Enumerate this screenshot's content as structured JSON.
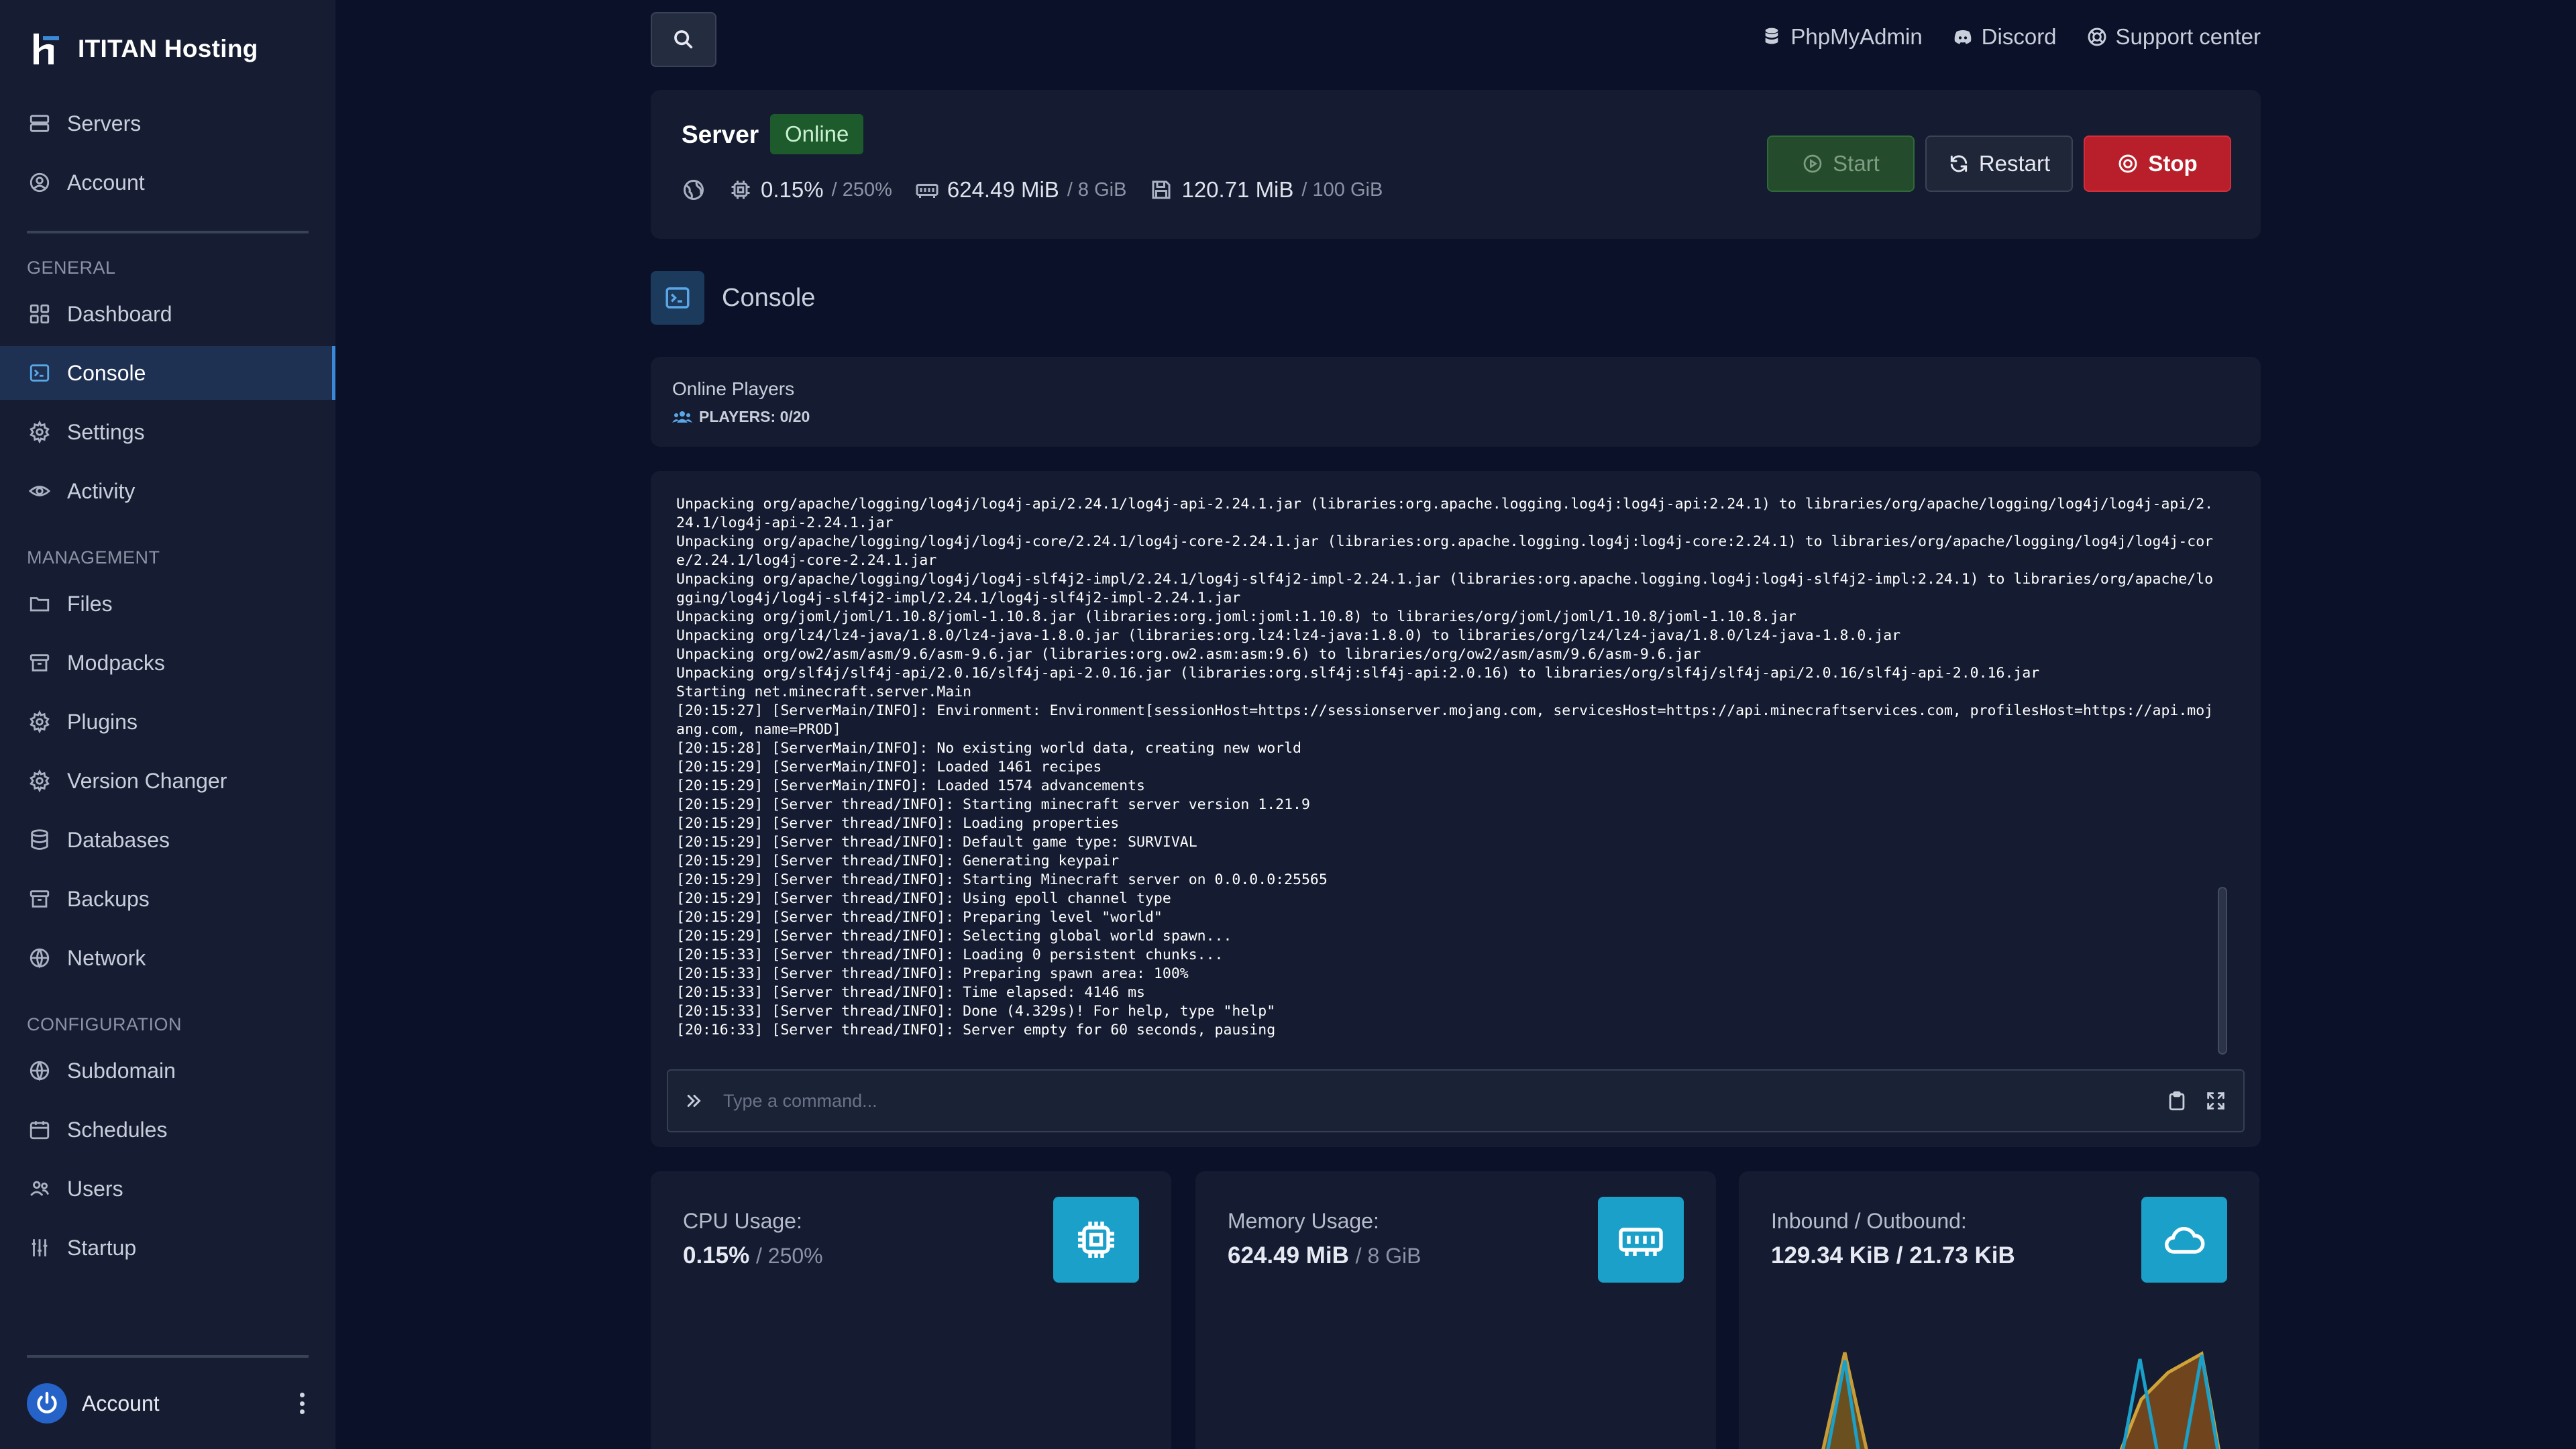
{
  "brand": {
    "name": "ITITAN Hosting"
  },
  "sidebar": {
    "top_items": [
      {
        "label": "Servers",
        "icon": "server-icon"
      },
      {
        "label": "Account",
        "icon": "user-circle-icon"
      }
    ],
    "sections": {
      "general": "GENERAL",
      "management": "MANAGEMENT",
      "configuration": "CONFIGURATION"
    },
    "general_items": [
      {
        "label": "Dashboard",
        "icon": "dashboard-icon"
      },
      {
        "label": "Console",
        "icon": "terminal-icon",
        "active": true
      },
      {
        "label": "Settings",
        "icon": "gear-icon"
      },
      {
        "label": "Activity",
        "icon": "eye-icon"
      }
    ],
    "management_items": [
      {
        "label": "Files",
        "icon": "folder-icon"
      },
      {
        "label": "Modpacks",
        "icon": "archive-icon"
      },
      {
        "label": "Plugins",
        "icon": "gear-icon"
      },
      {
        "label": "Version Changer",
        "icon": "gear-icon"
      },
      {
        "label": "Databases",
        "icon": "database-icon"
      },
      {
        "label": "Backups",
        "icon": "archive-icon"
      },
      {
        "label": "Network",
        "icon": "globe-icon"
      }
    ],
    "configuration_items": [
      {
        "label": "Subdomain",
        "icon": "globe-icon"
      },
      {
        "label": "Schedules",
        "icon": "calendar-icon"
      },
      {
        "label": "Users",
        "icon": "users-icon"
      },
      {
        "label": "Startup",
        "icon": "sliders-icon"
      }
    ],
    "account_label": "Account"
  },
  "topbar": {
    "links": [
      {
        "label": "PhpMyAdmin",
        "icon": "database-icon"
      },
      {
        "label": "Discord",
        "icon": "discord-icon"
      },
      {
        "label": "Support center",
        "icon": "lifebuoy-icon"
      }
    ]
  },
  "server": {
    "title": "Server",
    "status": "Online",
    "cpu": "0.15%",
    "cpu_limit": "/ 250%",
    "memory": "624.49 MiB",
    "memory_limit": "/ 8 GiB",
    "disk": "120.71 MiB",
    "disk_limit": "/ 100 GiB",
    "buttons": {
      "start": "Start",
      "restart": "Restart",
      "stop": "Stop"
    },
    "colors": {
      "online": "#1d5a2c",
      "start": "#244b2b",
      "stop": "#b81f2a",
      "accent": "#1aa0c9"
    }
  },
  "console": {
    "title": "Console",
    "players_title": "Online Players",
    "players_count": "PLAYERS: 0/20",
    "command_placeholder": "Type a command...",
    "lines": [
      "Unpacking org/apache/logging/log4j/log4j-api/2.24.1/log4j-api-2.24.1.jar (libraries:org.apache.logging.log4j:log4j-api:2.24.1) to libraries/org/apache/logging/log4j/log4j-api/2.24.1/log4j-api-2.24.1.jar",
      "Unpacking org/apache/logging/log4j/log4j-core/2.24.1/log4j-core-2.24.1.jar (libraries:org.apache.logging.log4j:log4j-core:2.24.1) to libraries/org/apache/logging/log4j/log4j-core/2.24.1/log4j-core-2.24.1.jar",
      "Unpacking org/apache/logging/log4j/log4j-slf4j2-impl/2.24.1/log4j-slf4j2-impl-2.24.1.jar (libraries:org.apache.logging.log4j:log4j-slf4j2-impl:2.24.1) to libraries/org/apache/logging/log4j/log4j-slf4j2-impl/2.24.1/log4j-slf4j2-impl-2.24.1.jar",
      "Unpacking org/joml/joml/1.10.8/joml-1.10.8.jar (libraries:org.joml:joml:1.10.8) to libraries/org/joml/joml/1.10.8/joml-1.10.8.jar",
      "Unpacking org/lz4/lz4-java/1.8.0/lz4-java-1.8.0.jar (libraries:org.lz4:lz4-java:1.8.0) to libraries/org/lz4/lz4-java/1.8.0/lz4-java-1.8.0.jar",
      "Unpacking org/ow2/asm/asm/9.6/asm-9.6.jar (libraries:org.ow2.asm:asm:9.6) to libraries/org/ow2/asm/asm/9.6/asm-9.6.jar",
      "Unpacking org/slf4j/slf4j-api/2.0.16/slf4j-api-2.0.16.jar (libraries:org.slf4j:slf4j-api:2.0.16) to libraries/org/slf4j/slf4j-api/2.0.16/slf4j-api-2.0.16.jar",
      "Starting net.minecraft.server.Main",
      "[20:15:27] [ServerMain/INFO]: Environment: Environment[sessionHost=https://sessionserver.mojang.com, servicesHost=https://api.minecraftservices.com, profilesHost=https://api.mojang.com, name=PROD]",
      "[20:15:28] [ServerMain/INFO]: No existing world data, creating new world",
      "[20:15:29] [ServerMain/INFO]: Loaded 1461 recipes",
      "[20:15:29] [ServerMain/INFO]: Loaded 1574 advancements",
      "[20:15:29] [Server thread/INFO]: Starting minecraft server version 1.21.9",
      "[20:15:29] [Server thread/INFO]: Loading properties",
      "[20:15:29] [Server thread/INFO]: Default game type: SURVIVAL",
      "[20:15:29] [Server thread/INFO]: Generating keypair",
      "[20:15:29] [Server thread/INFO]: Starting Minecraft server on 0.0.0.0:25565",
      "[20:15:29] [Server thread/INFO]: Using epoll channel type",
      "[20:15:29] [Server thread/INFO]: Preparing level \"world\"",
      "[20:15:29] [Server thread/INFO]: Selecting global world spawn...",
      "[20:15:33] [Server thread/INFO]: Loading 0 persistent chunks...",
      "[20:15:33] [Server thread/INFO]: Preparing spawn area: 100%",
      "[20:15:33] [Server thread/INFO]: Time elapsed: 4146 ms",
      "[20:15:33] [Server thread/INFO]: Done (4.329s)! For help, type \"help\"",
      "[20:16:33] [Server thread/INFO]: Server empty for 60 seconds, pausing"
    ]
  },
  "stats_cards": {
    "cpu": {
      "label": "CPU Usage:",
      "value": "0.15%",
      "limit": "/ 250%",
      "icon": "cpu-icon"
    },
    "memory": {
      "label": "Memory Usage:",
      "value": "624.49 MiB",
      "limit": "/ 8 GiB",
      "icon": "memory-icon"
    },
    "network": {
      "label": "Inbound / Outbound:",
      "value": "129.34 KiB / 21.73 KiB",
      "icon": "cloud-icon"
    }
  }
}
